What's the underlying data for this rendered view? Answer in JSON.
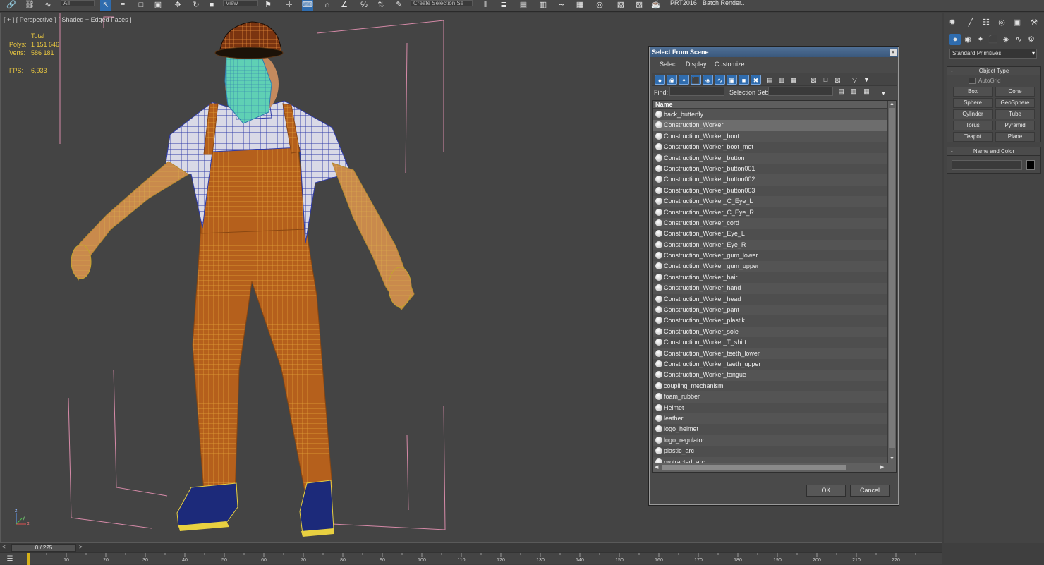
{
  "toolbar": {
    "dropdown_all": "All",
    "dropdown_view": "View",
    "selection_set": "Create Selection Se",
    "prt_label": "PRT2016",
    "batch_render": "Batch Render..",
    "icons": [
      "link-icon",
      "unlink-icon",
      "bind-space-warp-icon",
      "select-icon",
      "select-by-name-icon",
      "rect-region-icon",
      "window-crossing-icon",
      "move-icon",
      "rotate-icon",
      "scale-icon",
      "select-manipulate-icon",
      "snap-icon",
      "angle-snap-icon",
      "percent-snap-icon",
      "spinner-snap-icon",
      "edit-named-sel-icon",
      "mirror-icon",
      "align-icon",
      "layer-icon",
      "graphite-icon",
      "curve-editor-icon",
      "schematic-icon",
      "material-editor-icon",
      "render-setup-icon",
      "render-frame-icon",
      "render-icon"
    ]
  },
  "viewport": {
    "label_plus": "[ + ]",
    "label_view": "[ Perspective ]",
    "label_shading": "[ Shaded + Edged Faces ]",
    "stats": {
      "total_label": "Total",
      "polys_label": "Polys:",
      "polys_value": "1 151 646",
      "verts_label": "Verts:",
      "verts_value": "586 181",
      "fps_label": "FPS:",
      "fps_value": "6,933"
    },
    "axis": {
      "z": "z",
      "y": "y",
      "x": "x"
    }
  },
  "command_panel": {
    "tabs": [
      "create-icon",
      "modify-icon",
      "hierarchy-icon",
      "motion-icon",
      "display-icon",
      "utilities-icon"
    ],
    "subcategory": "Standard Primitives",
    "object_type_title": "Object Type",
    "autogrid": "AutoGrid",
    "primitives": [
      "Box",
      "Cone",
      "Sphere",
      "GeoSphere",
      "Cylinder",
      "Tube",
      "Torus",
      "Pyramid",
      "Teapot",
      "Plane"
    ],
    "name_color_title": "Name and Color",
    "name_value": ""
  },
  "dialog": {
    "title": "Select From Scene",
    "close": "x",
    "menu": [
      "Select",
      "Display",
      "Customize"
    ],
    "find_label": "Find:",
    "find_value": "",
    "selection_set_label": "Selection Set:",
    "selection_set_value": "",
    "column_name": "Name",
    "rows": [
      "back_butterfly",
      "Construction_Worker",
      "Construction_Worker_boot",
      "Construction_Worker_boot_met",
      "Construction_Worker_button",
      "Construction_Worker_button001",
      "Construction_Worker_button002",
      "Construction_Worker_button003",
      "Construction_Worker_C_Eye_L",
      "Construction_Worker_C_Eye_R",
      "Construction_Worker_cord",
      "Construction_Worker_Eye_L",
      "Construction_Worker_Eye_R",
      "Construction_Worker_gum_lower",
      "Construction_Worker_gum_upper",
      "Construction_Worker_hair",
      "Construction_Worker_hand",
      "Construction_Worker_head",
      "Construction_Worker_pant",
      "Construction_Worker_plastik",
      "Construction_Worker_sole",
      "Construction_Worker_T_shirt",
      "Construction_Worker_teeth_lower",
      "Construction_Worker_teeth_upper",
      "Construction_Worker_tongue",
      "coupling_mechanism",
      "foam_rubber",
      "Helmet",
      "leather",
      "logo_helmet",
      "logo_regulator",
      "plastic_arc",
      "protracted_arc"
    ],
    "selected_row": "Construction_Worker",
    "ok_label": "OK",
    "cancel_label": "Cancel"
  },
  "timeline": {
    "frame_display": "0 / 225",
    "prev": "<",
    "next": ">",
    "ticks": [
      10,
      20,
      30,
      40,
      50,
      60,
      70,
      80,
      90,
      100,
      110,
      120,
      130,
      140,
      150,
      160,
      170,
      180,
      190,
      200,
      210,
      220
    ],
    "current_frame": 0,
    "total_frames": 225
  }
}
